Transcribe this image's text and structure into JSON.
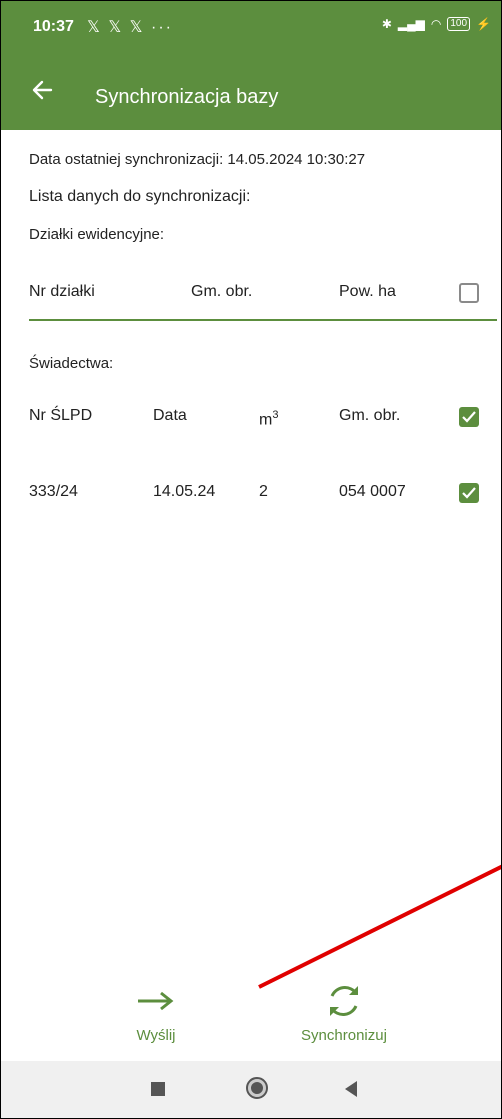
{
  "status_bar": {
    "time": "10:37",
    "notifications": "𝕏 𝕏 𝕏 ···",
    "battery": "100"
  },
  "app_bar": {
    "title": "Synchronizacja bazy"
  },
  "sync_info": {
    "last_sync_label": "Data ostatniej synchronizacji: 14.05.2024 10:30:27",
    "list_title": "Lista danych do synchronizacji:"
  },
  "parcels": {
    "section_label": "Działki ewidencyjne:",
    "columns": [
      "Nr działki",
      "Gm. obr.",
      "Pow. ha"
    ],
    "select_all_checked": false
  },
  "certificates": {
    "section_label": "Świadectwa:",
    "columns": [
      "Nr ŚLPD",
      "Data",
      "m",
      "3",
      "Gm. obr."
    ],
    "select_all_checked": true,
    "rows": [
      {
        "nr": "333/24",
        "date": "14.05.24",
        "m3": "2",
        "gm": "054 0007",
        "checked": true
      }
    ]
  },
  "bottom_actions": {
    "send_label": "Wyślij",
    "sync_label": "Synchronizuj"
  },
  "colors": {
    "accent": "#5c8e3e",
    "annotation": "#e00000"
  }
}
